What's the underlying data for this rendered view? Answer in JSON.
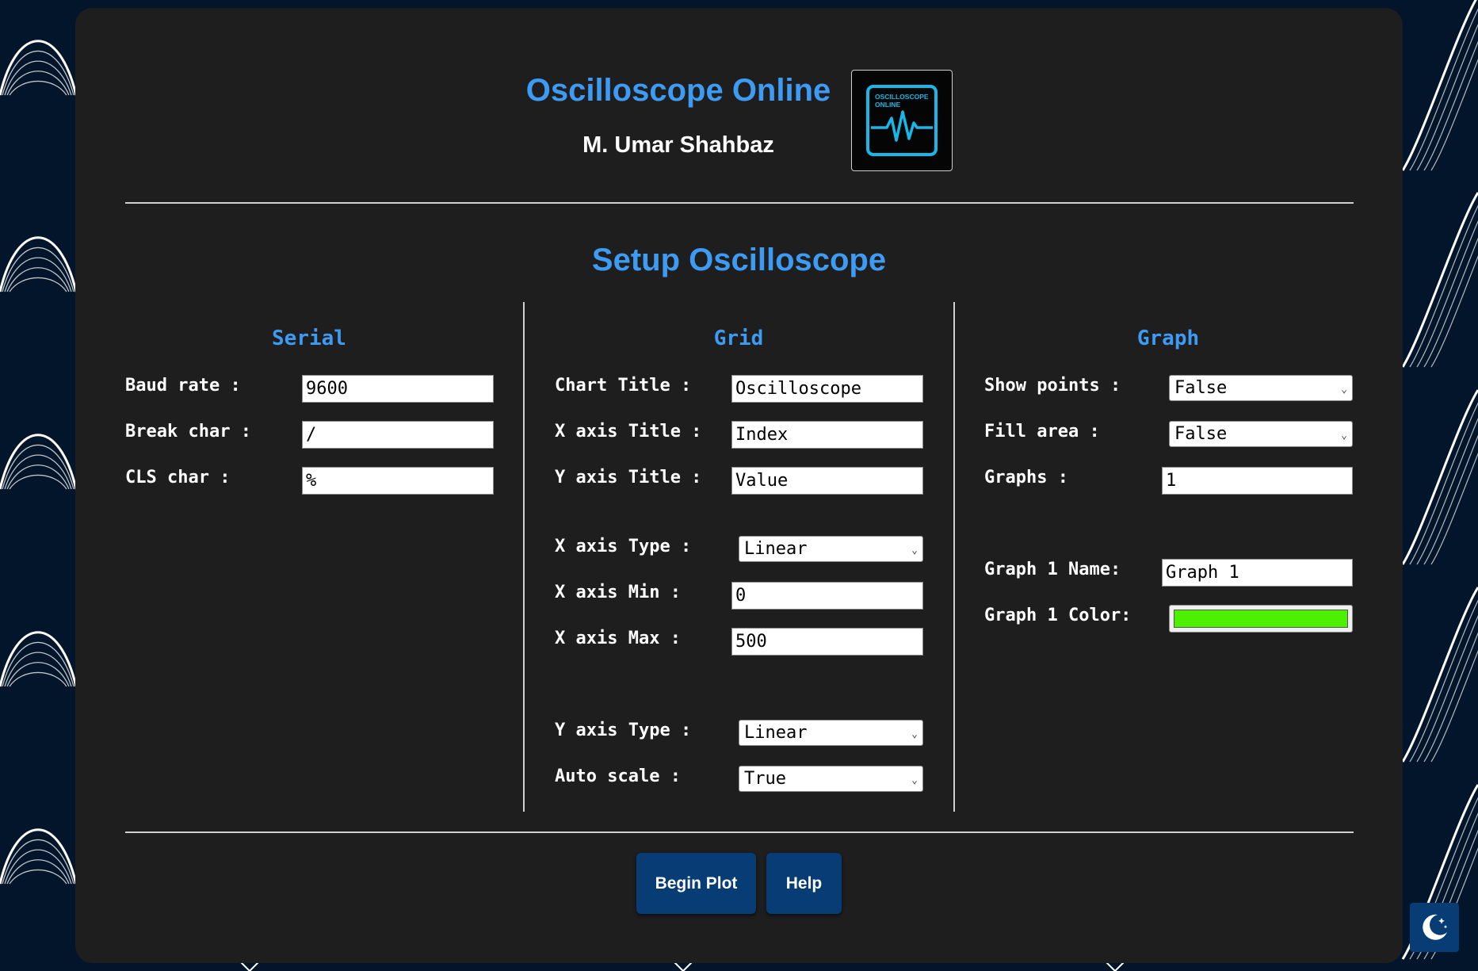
{
  "header": {
    "title": "Oscilloscope Online",
    "author": "M. Umar Shahbaz",
    "logo_text_line1": "OSCILLOSCOPE",
    "logo_text_line2": "ONLINE"
  },
  "setup_title": "Setup Oscilloscope",
  "serial": {
    "title": "Serial",
    "fields": [
      {
        "label": "Baud rate :",
        "value": "9600"
      },
      {
        "label": "Break char :",
        "value": "/"
      },
      {
        "label": "CLS char :",
        "value": "%"
      }
    ]
  },
  "grid": {
    "title": "Grid",
    "chart_title": {
      "label": "Chart Title :",
      "value": "Oscilloscope"
    },
    "x_axis_title": {
      "label": "X axis Title :",
      "value": "Index"
    },
    "y_axis_title": {
      "label": "Y axis Title :",
      "value": "Value"
    },
    "x_axis_type": {
      "label": "X axis Type :",
      "value": "Linear"
    },
    "x_axis_min": {
      "label": "X axis Min :",
      "value": "0"
    },
    "x_axis_max": {
      "label": "X axis Max :",
      "value": "500"
    },
    "y_axis_type": {
      "label": "Y axis Type :",
      "value": "Linear"
    },
    "auto_scale": {
      "label": "Auto scale :",
      "value": "True"
    }
  },
  "graph": {
    "title": "Graph",
    "show_points": {
      "label": "Show points :",
      "value": "False"
    },
    "fill_area": {
      "label": "Fill area :",
      "value": "False"
    },
    "graphs": {
      "label": "Graphs :",
      "value": "1"
    },
    "graph1_name": {
      "label": "Graph 1 Name:",
      "value": "Graph 1"
    },
    "graph1_color": {
      "label": "Graph 1 Color:",
      "value": "#4cf000"
    }
  },
  "buttons": {
    "begin_plot": "Begin Plot",
    "help": "Help"
  },
  "icons": {
    "theme_toggle": "moon-icon",
    "logo": "oscilloscope-wave-icon"
  },
  "colors": {
    "accent": "#3d9bf4",
    "button": "#073c74",
    "panel": "#1e1e1e",
    "background": "#03152b"
  }
}
